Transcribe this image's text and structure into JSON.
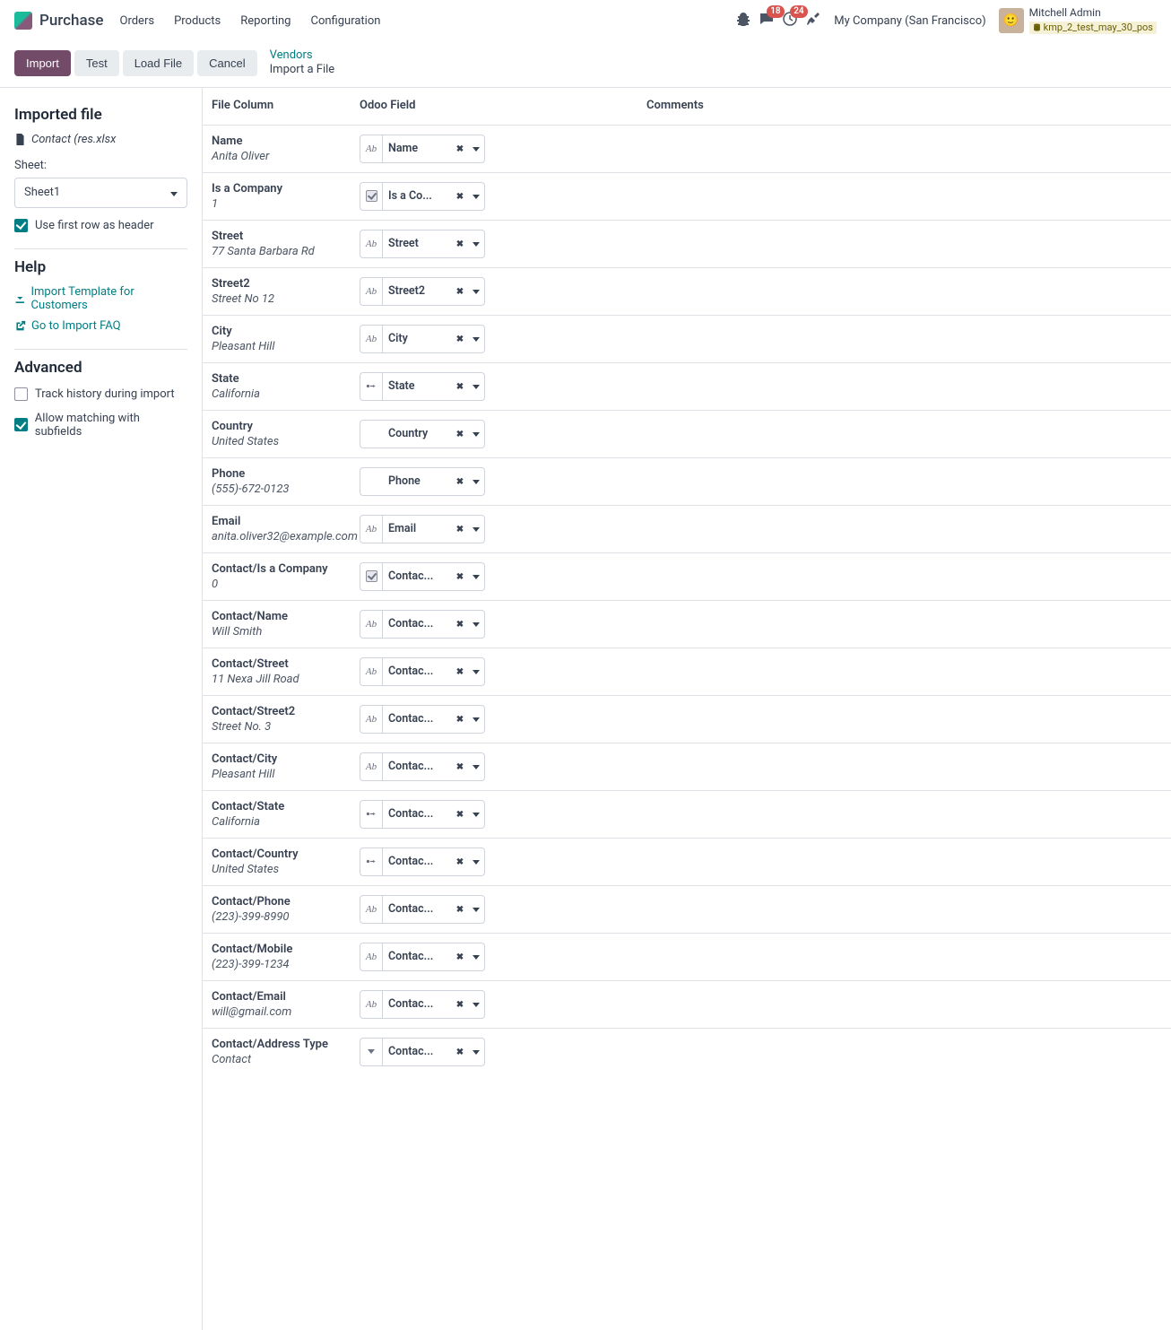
{
  "nav": {
    "brand": "Purchase",
    "items": [
      "Orders",
      "Products",
      "Reporting",
      "Configuration"
    ],
    "msg_badge": "18",
    "act_badge": "24",
    "company": "My Company (San Francisco)",
    "user_name": "Mitchell Admin",
    "db_name": "kmp_2_test_may_30_pos"
  },
  "control": {
    "import": "Import",
    "test": "Test",
    "load": "Load File",
    "cancel": "Cancel",
    "bc_link": "Vendors",
    "bc_current": "Import a File"
  },
  "sidebar": {
    "imported_title": "Imported file",
    "file_name": "Contact (res.xlsx",
    "sheet_label": "Sheet:",
    "sheet_value": "Sheet1",
    "use_header": "Use first row as header",
    "help_title": "Help",
    "tpl_link": "Import Template for Customers",
    "faq_link": "Go to Import FAQ",
    "advanced_title": "Advanced",
    "track_history": "Track history during import",
    "allow_subfields": "Allow matching with subfields"
  },
  "headers": {
    "file_col": "File Column",
    "odoo_field": "Odoo Field",
    "comments": "Comments"
  },
  "rows": [
    {
      "name": "Name",
      "sample": "Anita Oliver",
      "type": "text",
      "field": "Name"
    },
    {
      "name": "Is a Company",
      "sample": "1",
      "type": "bool",
      "field": "Is a Co..."
    },
    {
      "name": "Street",
      "sample": "77 Santa Barbara Rd",
      "type": "text",
      "field": "Street"
    },
    {
      "name": "Street2",
      "sample": "Street No 12",
      "type": "text",
      "field": "Street2"
    },
    {
      "name": "City",
      "sample": "Pleasant Hill",
      "type": "text",
      "field": "City"
    },
    {
      "name": "State",
      "sample": "California",
      "type": "m2o",
      "field": "State"
    },
    {
      "name": "Country",
      "sample": "United States",
      "type": "none",
      "field": "Country"
    },
    {
      "name": "Phone",
      "sample": "(555)-672-0123",
      "type": "none",
      "field": "Phone"
    },
    {
      "name": "Email",
      "sample": "anita.oliver32@example.com",
      "type": "text",
      "field": "Email"
    },
    {
      "name": "Contact/Is a Company",
      "sample": "0",
      "type": "bool",
      "field": "Contac..."
    },
    {
      "name": "Contact/Name",
      "sample": "Will Smith",
      "type": "text",
      "field": "Contac..."
    },
    {
      "name": "Contact/Street",
      "sample": "11 Nexa Jill Road",
      "type": "text",
      "field": "Contac..."
    },
    {
      "name": "Contact/Street2",
      "sample": "Street No. 3",
      "type": "text",
      "field": "Contac..."
    },
    {
      "name": "Contact/City",
      "sample": "Pleasant Hill",
      "type": "text",
      "field": "Contac..."
    },
    {
      "name": "Contact/State",
      "sample": "California",
      "type": "m2o",
      "field": "Contac..."
    },
    {
      "name": "Contact/Country",
      "sample": "United States",
      "type": "m2o",
      "field": "Contac..."
    },
    {
      "name": "Contact/Phone",
      "sample": "(223)-399-8990",
      "type": "text",
      "field": "Contac..."
    },
    {
      "name": "Contact/Mobile",
      "sample": "(223)-399-1234",
      "type": "text",
      "field": "Contac..."
    },
    {
      "name": "Contact/Email",
      "sample": "will@gmail.com",
      "type": "text",
      "field": "Contac..."
    },
    {
      "name": "Contact/Address Type",
      "sample": "Contact",
      "type": "sel",
      "field": "Contac..."
    }
  ]
}
